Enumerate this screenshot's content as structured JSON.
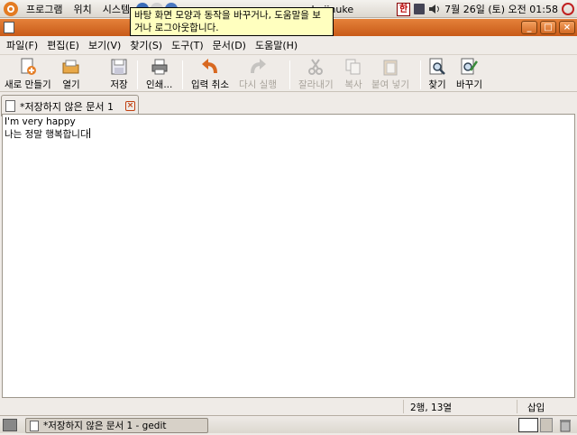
{
  "top_panel": {
    "menus": [
      "프로그램",
      "위치",
      "시스템"
    ],
    "username": "lmjinuke",
    "input_method": "한",
    "clock": "7월 26일 (토) 오전 01:58"
  },
  "tooltip": {
    "text": "바탕 화면 모양과 동작을 바꾸거나, 도움말을 보거나 로그아웃합니다."
  },
  "menubar": {
    "items": [
      "파일(F)",
      "편집(E)",
      "보기(V)",
      "찾기(S)",
      "도구(T)",
      "문서(D)",
      "도움말(H)"
    ]
  },
  "toolbar": {
    "new": "새로 만들기",
    "open": "열기",
    "save": "저장",
    "print": "인쇄...",
    "undo": "입력 취소",
    "redo": "다시 실행",
    "cut": "잘라내기",
    "copy": "복사",
    "paste": "붙여 넣기",
    "find": "찾기",
    "replace": "바꾸기"
  },
  "tab": {
    "title": "*저장하지 않은 문서 1"
  },
  "editor": {
    "lines": [
      "I'm very happy",
      "나는 정말 행복합니다"
    ]
  },
  "statusbar": {
    "position": "2행, 13열",
    "mode": "삽입"
  },
  "taskbar": {
    "window_label": "*저장하지 않은 문서 1 - gedit"
  },
  "colors": {
    "title_bar": "#d8712c",
    "panel": "#dcd7cf",
    "tooltip_bg": "#ffffbf"
  }
}
